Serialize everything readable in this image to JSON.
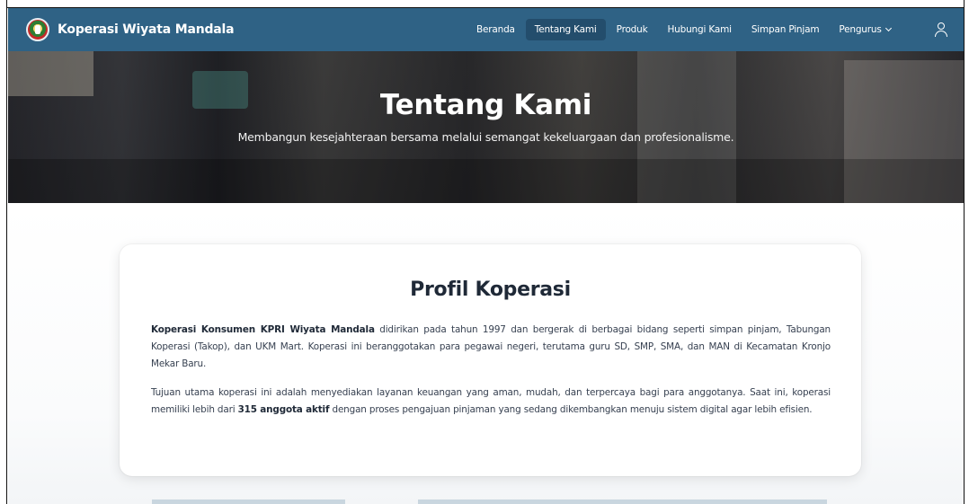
{
  "brand": {
    "name": "Koperasi Wiyata Mandala"
  },
  "nav": {
    "links": [
      "Beranda",
      "Tentang Kami",
      "Produk",
      "Hubungi Kami",
      "Simpan Pinjam"
    ],
    "active": "Tentang Kami",
    "dropdown_label": "Pengurus",
    "user_icon": "user-icon"
  },
  "hero": {
    "title": "Tentang Kami",
    "subtitle": "Membangun kesejahteraan bersama melalui semangat kekeluargaan dan profesionalisme."
  },
  "profile": {
    "title": "Profil Koperasi",
    "p1_bold": "Koperasi Konsumen KPRI Wiyata Mandala",
    "p1_rest": " didirikan pada tahun 1997 dan bergerak di berbagai bidang seperti simpan pinjam, Tabungan Koperasi (Takop), dan UKM Mart. Koperasi ini beranggotakan para pegawai negeri, terutama guru SD, SMP, SMA, dan MAN di Kecamatan Kronjo Mekar Baru.",
    "p2_start": "Tujuan utama koperasi ini adalah menyediakan layanan keuangan yang aman, mudah, dan terpercaya bagi para anggotanya. Saat ini, koperasi memiliki lebih dari ",
    "p2_bold": "315 anggota aktif",
    "p2_end": " dengan proses pengajuan pinjaman yang sedang dikembangkan menuju sistem digital agar lebih efisien."
  },
  "colors": {
    "navbar": "#2f6285",
    "active_link": "#234d6c"
  }
}
